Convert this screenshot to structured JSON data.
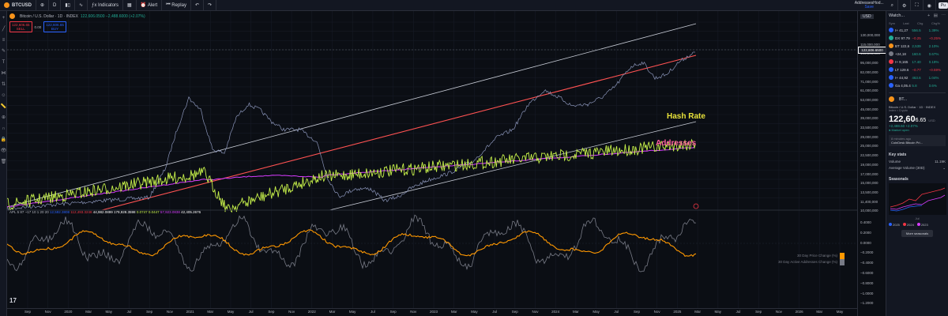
{
  "toolbar": {
    "symbol": "BTCUSD",
    "interval": "D",
    "indicators_label": "Indicators",
    "alert_label": "Alert",
    "replay_label": "Replay",
    "account": "AddressesHod...",
    "account_sub": "Save",
    "publish_label": "Pu"
  },
  "chart": {
    "title": "Bitcoin / U.S. Dollar · 1D · INDEX",
    "ohlc": "122,606.0500 −2,488.6000 (+2.07%)",
    "sell_price": "122,606.65",
    "sell_label": "SELL",
    "buy_price": "122,606.65",
    "buy_label": "BUY",
    "spread": "0.00",
    "currency": "USD",
    "current_price": "122,606.6500",
    "indicator_values": [
      {
        "text": "APL 5 87 ~17 10 1 20 20",
        "color": "#b2b5be"
      },
      {
        "text": "12,592.3808",
        "color": "#2962ff"
      },
      {
        "text": "112,493.3248",
        "color": "#f23645"
      },
      {
        "text": "44,982.0899",
        "color": "#ffffff"
      },
      {
        "text": "179,928.3598",
        "color": "#ffffff"
      },
      {
        "text": "0.0747",
        "color": "#c6f04a"
      },
      {
        "text": "0.0447",
        "color": "#c6f04a"
      },
      {
        "text": "57,923.0838",
        "color": "#d83cff"
      },
      {
        "text": "42,405.2676",
        "color": "#ffffff"
      }
    ],
    "annotations": {
      "hash_rate": "Hash Rate",
      "addresses": "Addresses"
    },
    "price_axis": [
      "130,000,000",
      "115,000,000",
      "105,000,000",
      "95,000,000",
      "82,000,000",
      "71,000,000",
      "61,000,000",
      "53,000,000",
      "45,000,000",
      "39,000,000",
      "33,500,000",
      "29,000,000",
      "25,000,000",
      "22,500,000",
      "19,000,000",
      "17,000,000",
      "15,000,000",
      "13,500,000",
      "11,400,000",
      "10,000,000"
    ],
    "osc_axis": [
      "0.4000",
      "0.2000",
      "0.0000",
      "−0.2000",
      "−0.4000",
      "−0.6000",
      "−0.8000",
      "−1.0000",
      "−1.2000"
    ],
    "osc_legend": [
      "30 Day Price Change (%)",
      "30 Day Active Addresses Change (%)"
    ],
    "osc_colors": [
      "#ff9800",
      "#787b86"
    ],
    "time_axis": [
      "Sep",
      "Nov",
      "2020",
      "Mar",
      "May",
      "Jul",
      "Sep",
      "Nov",
      "2021",
      "Mar",
      "May",
      "Jul",
      "Sep",
      "Nov",
      "2022",
      "Mar",
      "May",
      "Jul",
      "Sep",
      "Nov",
      "2023",
      "Mar",
      "May",
      "Jul",
      "Sep",
      "Nov",
      "2024",
      "Mar",
      "May",
      "Jul",
      "Sep",
      "Nov",
      "2025",
      "Mar",
      "May",
      "Jul",
      "Sep",
      "Nov",
      "2026",
      "Mar",
      "May"
    ]
  },
  "colors": {
    "hash_rate": "#c6f04a",
    "addresses": "#d83cff",
    "trend_red": "#ff5252",
    "price": "#8a94b8",
    "oscillator_price": "#ff9800",
    "oscillator_addr": "#787b86",
    "annotation_hash": "#e8e23a",
    "annotation_addr": "#ff5ea0"
  },
  "right_panel": {
    "title": "Watch...",
    "columns": [
      "Sym",
      "Last",
      "Chg",
      "Chg%"
    ],
    "rows": [
      {
        "sym": "I+ 41,27",
        "last": "556.5",
        "chg": "1.39%",
        "color": "#22ab94",
        "icon": "#2962ff"
      },
      {
        "sym": "DX 97.79",
        "last": "−0.25",
        "chg": "−0.25%",
        "color": "#f23645",
        "icon": "#22ab94"
      },
      {
        "sym": "BT 122,6",
        "last": "2,539",
        "chg": "2.10%",
        "color": "#22ab94",
        "icon": "#f7931a"
      },
      {
        "sym": "+24,18",
        "last": "160.6",
        "chg": "0.67%",
        "color": "#22ab94",
        "icon": "#787b86"
      },
      {
        "sym": "I+ 9,165",
        "last": "17.40",
        "chg": "0.19%",
        "color": "#22ab94",
        "icon": "#f23645"
      },
      {
        "sym": "LT 129.6",
        "last": "−0.77",
        "chg": "−0.59%",
        "color": "#f23645",
        "icon": "#2962ff"
      },
      {
        "sym": "I+ 44,92",
        "last": "463.6",
        "chg": "1.04%",
        "color": "#22ab94",
        "icon": "#2962ff"
      },
      {
        "sym": "Ga 4,05.4",
        "last": "5.8",
        "chg": "0.6%",
        "color": "#22ab94",
        "icon": "#2962ff"
      }
    ],
    "card_symbol": "BT...",
    "card_name": "Bitcoin / U.S. Dollar · 1D · INDEX",
    "card_sub": "Index • Crypto",
    "card_price_main": "122,60",
    "card_price_tail": "6.65",
    "card_price_ccy": "USD",
    "card_change": "+2,488.60 +2.07%",
    "card_market": "● Market open",
    "news_time": "8 minutes ago",
    "news_text": "CoinDesk Bitcoin Pri...",
    "key_stats_label": "Key stats",
    "volume_label": "Volume",
    "volume_value": "11.19K",
    "avg_volume_label": "Average Volume (30D)",
    "avg_volume_value": "",
    "seasonals_label": "Seasonals",
    "seasonal_month": "Jul",
    "seasonal_years": [
      {
        "year": "2025",
        "color": "#2962ff"
      },
      {
        "year": "2024",
        "color": "#f23645"
      },
      {
        "year": "2023",
        "color": "#d83cff"
      }
    ],
    "more_seasonals": "More seasonals"
  }
}
